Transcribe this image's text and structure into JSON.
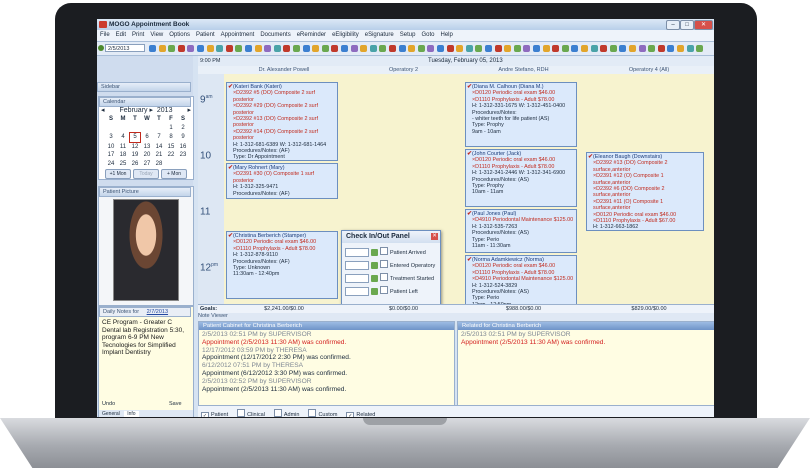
{
  "app": {
    "title": "MOGO Appointment Book"
  },
  "menu": [
    "File",
    "Edit",
    "Print",
    "View",
    "Options",
    "Patient",
    "Appointment",
    "Documents",
    "eReminder",
    "eEligibility",
    "eSignature",
    "Setup",
    "Goto",
    "Help"
  ],
  "toolbar": {
    "date_value": "2/5/2013"
  },
  "sidebar": {
    "sidebar_label": "Sidebar",
    "calendar_label": "Calendar",
    "month": "February",
    "year": "2013",
    "weekdays": [
      "S",
      "M",
      "T",
      "W",
      "T",
      "F",
      "S"
    ],
    "days": [
      "",
      "",
      "",
      "",
      "",
      "1",
      "2",
      "3",
      "4",
      "5",
      "6",
      "7",
      "8",
      "9",
      "10",
      "11",
      "12",
      "13",
      "14",
      "15",
      "16",
      "17",
      "18",
      "19",
      "20",
      "21",
      "22",
      "23",
      "24",
      "25",
      "26",
      "27",
      "28"
    ],
    "selected_day": "5",
    "btn_prev": "+1 Mon",
    "btn_today": "Today",
    "btn_next": "+ Mon",
    "picture_label": "Patient Picture",
    "notes_label": "Daily Notes for",
    "notes_date": "2/7/2013",
    "notes_text": "CE Program - Greater C Dental lab Registration 5:30, program 6-9 PM New Tecnologies for Simplified Implant Dentistry",
    "undo": "Undo",
    "save": "Save",
    "tab_general": "General",
    "tab_info": "Info"
  },
  "schedule": {
    "time_label": "9:00 PM",
    "date_header": "Tuesday, February 05, 2013",
    "providers": [
      "Dr. Alexander Powell",
      "Operatory 2",
      "Andre Stefano, RDH",
      "Operatory 4 (All)"
    ],
    "hours": [
      {
        "h": "9",
        "ampm": "am"
      },
      {
        "h": "10",
        "ampm": ""
      },
      {
        "h": "11",
        "ampm": ""
      },
      {
        "h": "12",
        "ampm": "pm"
      }
    ]
  },
  "appointments": [
    {
      "col": 0,
      "lines": [
        "(Kateri Bank (Kateri)",
        "×D2392 #5 (DO) Composite 2 surf posterior",
        "×D2392 #29 (DO) Composite 2 surf posterior",
        "×D2392 #13 (DO) Composite 2 surf posterior",
        "×D2392 #14 (DO) Composite 2 surf posterior",
        "H: 1-312-681-6389 W: 1-312-681-1464",
        "Procedures/Notes: (AF)",
        "Type: Dr Appointment",
        "9am - 10:30am"
      ]
    },
    {
      "col": 0,
      "lines": [
        "(Mary Rohnert (Mary)",
        "×D2391 #30 (O) Composite 1 surf posterior",
        "H: 1-312-325-9471",
        "Procedures/Notes: (AF)"
      ]
    },
    {
      "col": 0,
      "lines": [
        "(Christina Berberich (Stamper)",
        "×D0120 Periodic oral exam $46.00",
        "×D1110 Prophylaxis - Adult $78.00",
        "H: 1-312-878-9110",
        "Procedures/Notes: (AF)",
        "Type: Unknown",
        "11:30am - 12:40pm"
      ]
    },
    {
      "col": 2,
      "lines": [
        "(Diana M. Calhoun (Diana M.)",
        "×D0120 Periodic oral exam $46.00",
        "×D1110 Prophylaxis - Adult $78.00",
        "H: 1-312-331-1675 W: 1-312-451-0400",
        "Procedures/Notes:",
        "- whiter teeth for life patient (AS)",
        "Type: Prophy",
        "9am - 10am"
      ]
    },
    {
      "col": 2,
      "lines": [
        "(John Courter (Jack)",
        "×D0120 Periodic oral exam $46.00",
        "×D1110 Prophylaxis - Adult $78.00",
        "H: 1-312-341-2446 W: 1-312-341-6900",
        "Procedures/Notes: (AS)",
        "Type: Prophy",
        "10am - 11am"
      ]
    },
    {
      "col": 2,
      "lines": [
        "(Paul Jones (Paul)",
        "×D4910 Periodontal Maintenance $125.00",
        "H: 1-312-535-7263",
        "Procedures/Notes: (AS)",
        "Type: Perio",
        "11am - 11:30am"
      ]
    },
    {
      "col": 2,
      "lines": [
        "(Norma Adamkiewicz (Norma)",
        "×D0120 Periodic oral exam $46.00",
        "×D1110 Prophylaxis - Adult $78.00",
        "×D4910 Periodontal Maintenance $125.00",
        "H: 1-312-524-3829",
        "Procedures/Notes: (AS)",
        "Type: Perio",
        "12pm - 12:50pm"
      ]
    },
    {
      "col": 3,
      "lines": [
        "(Eleanor Baugh (Downstairs)",
        "×D2392 #13 (DO) Composite 2 surface,anterior",
        "×D2391 #12 (O) Composite 1 surface,anterior",
        "×D2392 #6 (DO) Composite 2 surface,anterior",
        "×D2391 #11 (O) Composite 1 surface,anterior",
        "×D0120 Periodic oral exam $46.00",
        "×D1110 Prophylaxis - Adult $67.00",
        "H: 1-312-663-1862",
        "Procedures/Notes: (AS)",
        "Type: Unknown",
        "10:30am - 12:40pm"
      ]
    }
  ],
  "checkin": {
    "title": "Check In/Out Panel",
    "items": [
      "Patient Arrived",
      "Entered Operatory",
      "Treatment Started",
      "Patient Left"
    ]
  },
  "goals": {
    "label": "Goals:",
    "values": [
      "$2,241.00/$0.00",
      "$0.00/$0.00",
      "$988.00/$0.00",
      "$829.00/$0.00"
    ]
  },
  "note_viewer": {
    "label": "Note Viewer"
  },
  "cabinet": {
    "title": "Patient Cabinet for Christina Berberich",
    "rows": [
      {
        "text": "2/5/2013 02:51 PM by SUPERVISOR",
        "style": "gray"
      },
      {
        "text": "Appointment (2/5/2013 11:30 AM) was confirmed.",
        "style": "red"
      },
      {
        "text": "12/17/2012 03:59 PM by THERESA",
        "style": "gray"
      },
      {
        "text": "Appointment (12/17/2012 2:30 PM) was confirmed.",
        "style": "dark"
      },
      {
        "text": "6/12/2012 07:51 PM by THERESA",
        "style": "gray"
      },
      {
        "text": "Appointment (6/12/2012 3:30 PM) was confirmed.",
        "style": "dark"
      },
      {
        "text": "2/5/2013 02:52 PM by SUPERVISOR",
        "style": "gray"
      },
      {
        "text": "Appointment (2/5/2013 11:30 AM) was confirmed.",
        "style": "dark"
      }
    ]
  },
  "related": {
    "title": "Related for Christina Berberich",
    "rows": [
      {
        "text": "2/5/2013 02:51 PM by SUPERVISOR",
        "style": "gray"
      },
      {
        "text": "Appointment (2/5/2013 11:30 AM) was confirmed.",
        "style": "red"
      }
    ]
  },
  "filters": [
    {
      "label": "Patient",
      "checked": true
    },
    {
      "label": "Clinical",
      "checked": false
    },
    {
      "label": "Admin",
      "checked": false
    },
    {
      "label": "Custom",
      "checked": false
    },
    {
      "label": "Related",
      "checked": true
    }
  ]
}
